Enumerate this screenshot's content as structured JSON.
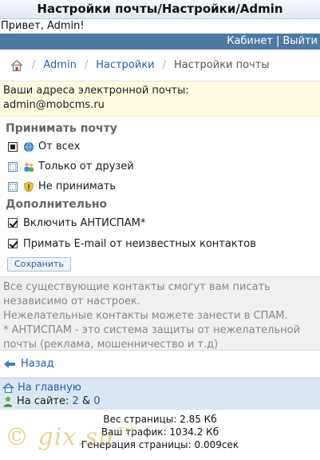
{
  "header": {
    "title": "Настройки почты/Настройки/Admin"
  },
  "greeting": "Привет, Admin!",
  "topbar": {
    "cabinet": "Кабинет",
    "separator": "|",
    "logout": "Выйти"
  },
  "breadcrumb": {
    "admin": "Admin",
    "settings": "Настройки",
    "current": "Настройки почты",
    "separator": "/"
  },
  "email": {
    "label": "Ваши адреса электронной почты:",
    "address": "admin@mobcms.ru"
  },
  "receive": {
    "title": "Принимать почту",
    "options": [
      {
        "label": "От всех",
        "selected": true
      },
      {
        "label": "Только от друзей",
        "selected": false
      },
      {
        "label": "Не принимать",
        "selected": false
      }
    ]
  },
  "extra": {
    "title": "Дополнительно",
    "antispam": "Включить АНТИСПАМ*",
    "unknown": "Примать E-mail от неизвестных контактов"
  },
  "save_label": "Сохранить",
  "notes": [
    "Все существующие контакты смогут вам писать",
    "независимо от настроек.",
    "Нежелательные контакты можете занести в СПАМ.",
    "* АНТИСПАМ - это система защиты от нежелательной",
    "почты (реклама, мошенничество и т.д)"
  ],
  "back_label": "Назад",
  "footer": {
    "home": "На главную",
    "online_label": "На сайте:",
    "online_users": "2",
    "amp": "&",
    "online_guests": "0"
  },
  "stats": {
    "page_weight": "Вес страницы: 2.85 Кб",
    "traffic": "Ваш трафик: 1034.2 Кб",
    "generation": "Генерация страницы: 0.009сек"
  },
  "watermark": "© gix.su™",
  "colors": {
    "topbar": "#4d79a4",
    "email_bg": "#fffbe2",
    "note_bg": "#f0f0f0",
    "footer_bg": "#dbe6f3",
    "link": "#1f5fa9"
  }
}
